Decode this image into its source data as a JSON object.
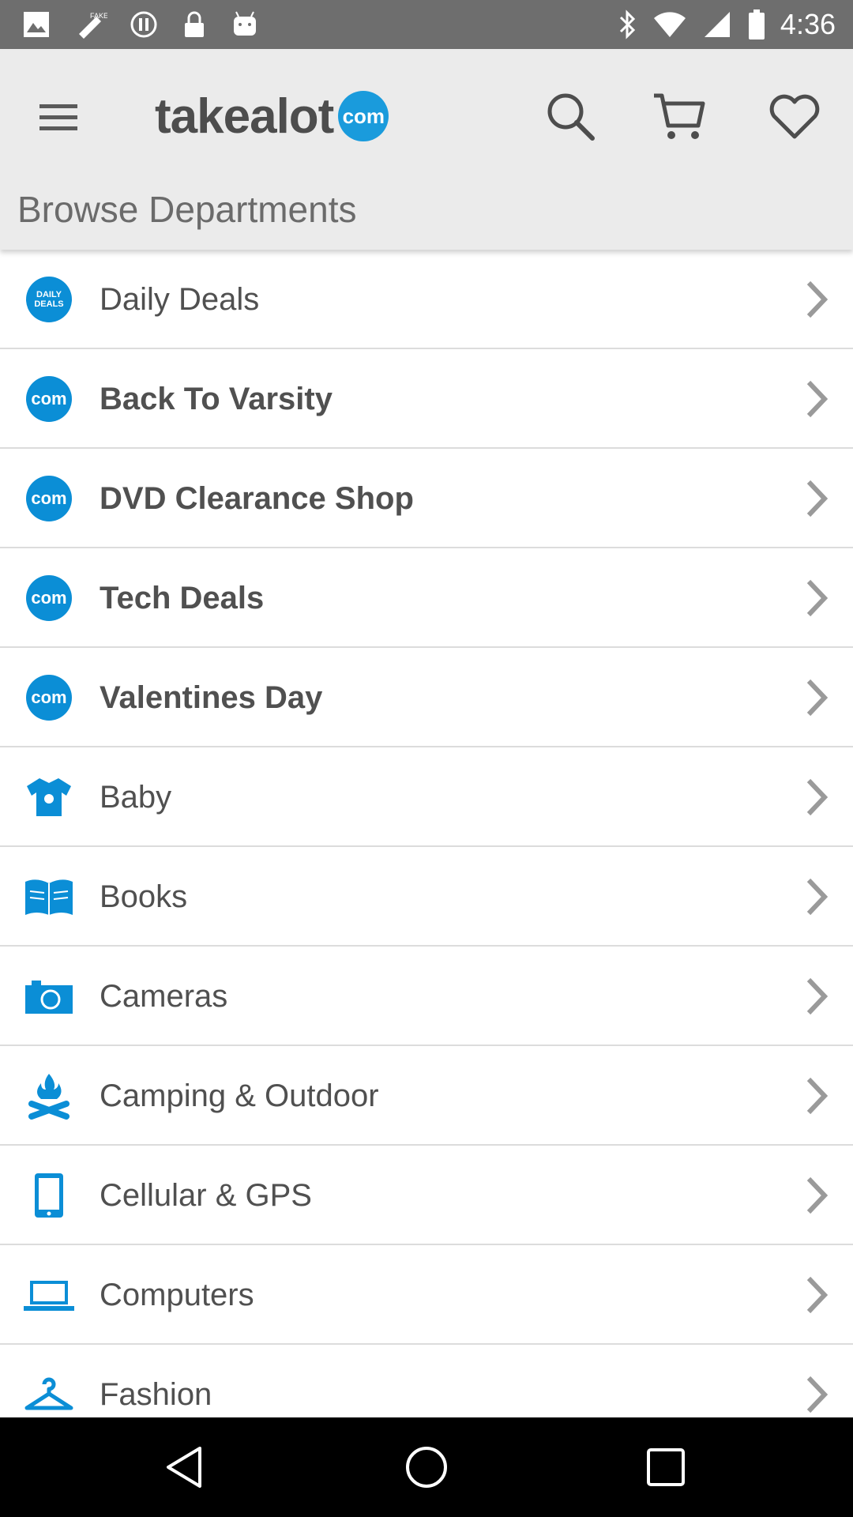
{
  "status_bar": {
    "time": "4:36",
    "icons": [
      "image-icon",
      "fake-gps-icon",
      "pause-circle-icon",
      "lock-icon",
      "android-icon",
      "bluetooth-icon",
      "wifi-icon",
      "signal-icon",
      "battery-icon"
    ]
  },
  "app_bar": {
    "brand_text": "takealot",
    "brand_badge": "com",
    "section_title": "Browse Departments",
    "brand_color": "#1a9bdc"
  },
  "departments": [
    {
      "label": "Daily Deals",
      "icon": "daily-deals-icon",
      "badge_line1": "DAILY",
      "badge_line2": "DEALS",
      "bold": false
    },
    {
      "label": "Back To Varsity",
      "icon": "com-icon",
      "badge": "com",
      "bold": true
    },
    {
      "label": "DVD Clearance Shop",
      "icon": "com-icon",
      "badge": "com",
      "bold": true
    },
    {
      "label": "Tech Deals",
      "icon": "com-icon",
      "badge": "com",
      "bold": true
    },
    {
      "label": "Valentines Day",
      "icon": "com-icon",
      "badge": "com",
      "bold": true
    },
    {
      "label": "Baby",
      "icon": "baby-onesie-icon",
      "bold": false
    },
    {
      "label": "Books",
      "icon": "book-icon",
      "bold": false
    },
    {
      "label": "Cameras",
      "icon": "camera-icon",
      "bold": false
    },
    {
      "label": "Camping & Outdoor",
      "icon": "campfire-icon",
      "bold": false
    },
    {
      "label": "Cellular & GPS",
      "icon": "phone-icon",
      "bold": false
    },
    {
      "label": "Computers",
      "icon": "laptop-icon",
      "bold": false
    },
    {
      "label": "Fashion",
      "icon": "hanger-icon",
      "bold": false
    }
  ],
  "nav_bar": {
    "icons": [
      "back-icon",
      "home-icon",
      "recent-apps-icon"
    ]
  }
}
